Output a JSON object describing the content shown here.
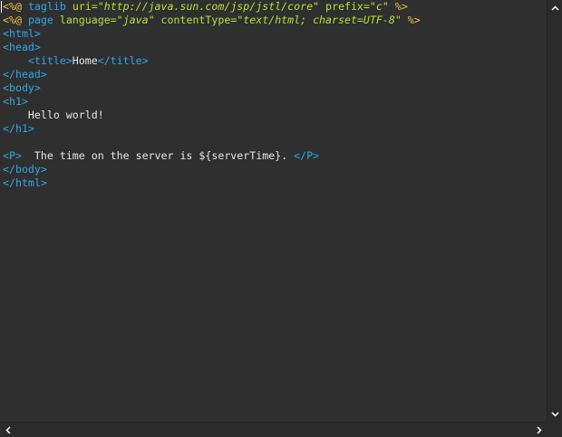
{
  "editor": {
    "lines": [
      {
        "tokens": [
          {
            "t": "<%@",
            "c": "delim"
          },
          {
            "t": " ",
            "c": "text"
          },
          {
            "t": "taglib",
            "c": "tag"
          },
          {
            "t": " ",
            "c": "text"
          },
          {
            "t": "uri=",
            "c": "attr"
          },
          {
            "t": "\"http://java.sun.com/jsp/jstl/core\"",
            "c": "str"
          },
          {
            "t": " ",
            "c": "text"
          },
          {
            "t": "prefix=",
            "c": "attr"
          },
          {
            "t": "\"c\"",
            "c": "str"
          },
          {
            "t": " ",
            "c": "text"
          },
          {
            "t": "%>",
            "c": "delim"
          }
        ]
      },
      {
        "tokens": [
          {
            "t": "<%@",
            "c": "delim"
          },
          {
            "t": " ",
            "c": "text"
          },
          {
            "t": "page",
            "c": "tag"
          },
          {
            "t": " ",
            "c": "text"
          },
          {
            "t": "language=",
            "c": "attr"
          },
          {
            "t": "\"java\"",
            "c": "str"
          },
          {
            "t": " ",
            "c": "text"
          },
          {
            "t": "contentType=",
            "c": "attr"
          },
          {
            "t": "\"text/html; charset=UTF-8\"",
            "c": "str"
          },
          {
            "t": " ",
            "c": "text"
          },
          {
            "t": "%>",
            "c": "delim"
          }
        ]
      },
      {
        "tokens": [
          {
            "t": "<html>",
            "c": "tag"
          }
        ]
      },
      {
        "tokens": [
          {
            "t": "<head>",
            "c": "tag"
          }
        ]
      },
      {
        "tokens": [
          {
            "t": "    ",
            "c": "text"
          },
          {
            "t": "<title>",
            "c": "tag"
          },
          {
            "t": "Home",
            "c": "text"
          },
          {
            "t": "</title>",
            "c": "tag"
          }
        ]
      },
      {
        "tokens": [
          {
            "t": "</head>",
            "c": "tag"
          }
        ]
      },
      {
        "tokens": [
          {
            "t": "<body>",
            "c": "tag"
          }
        ]
      },
      {
        "tokens": [
          {
            "t": "<h1>",
            "c": "tag"
          }
        ]
      },
      {
        "tokens": [
          {
            "t": "    Hello world!",
            "c": "text"
          }
        ]
      },
      {
        "tokens": [
          {
            "t": "</h1>",
            "c": "tag"
          }
        ]
      },
      {
        "tokens": []
      },
      {
        "tokens": [
          {
            "t": "<P>",
            "c": "tag"
          },
          {
            "t": "  The time on the server is ${serverTime}. ",
            "c": "text"
          },
          {
            "t": "</P>",
            "c": "tag"
          }
        ]
      },
      {
        "tokens": [
          {
            "t": "</body>",
            "c": "tag"
          }
        ]
      },
      {
        "tokens": [
          {
            "t": "</html>",
            "c": "tag"
          }
        ]
      }
    ]
  },
  "icons": {
    "scroll_up": "chevron-up-icon",
    "scroll_down": "chevron-down-icon",
    "scroll_left": "chevron-left-icon",
    "scroll_right": "chevron-right-icon"
  },
  "colors": {
    "background": "#2f2f2f",
    "delimiter": "#f0c040",
    "tag": "#2ea8e6",
    "attribute": "#b8e03a",
    "text": "#e6e6e6"
  }
}
